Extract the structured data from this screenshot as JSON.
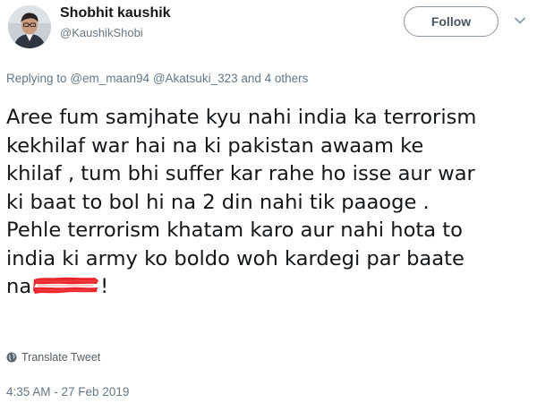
{
  "author": {
    "display_name": "Shobhit kaushik",
    "handle": "@KaushikShobi",
    "avatar_icon": "user-avatar-photo"
  },
  "follow_label": "Follow",
  "more_icon": "chevron-down-icon",
  "reply": {
    "prefix": "Replying to",
    "mentions": [
      "@em_maan94",
      "@Akatsuki_323"
    ],
    "suffix": "and 4 others"
  },
  "tweet_lines": [
    "Aree fum samjhate kyu nahi india ka terrorism",
    "kekhilaf war hai na ki pakistan awaam ke",
    "khilaf , tum bhi suffer kar rahe ho isse aur war",
    "ki baat to bol hi na 2 din nahi tik paaoge .",
    "Pehle terrorism khatam karo aur nahi hota to",
    "india ki army ko boldo woh kardegi par baate",
    "na"
  ],
  "redaction_tail": "!",
  "translate_label": "Translate Tweet",
  "timestamp": "4:35 AM - 27 Feb 2019",
  "colors": {
    "text": "#14171a",
    "secondary": "#657786",
    "redaction": "#e8262b"
  }
}
